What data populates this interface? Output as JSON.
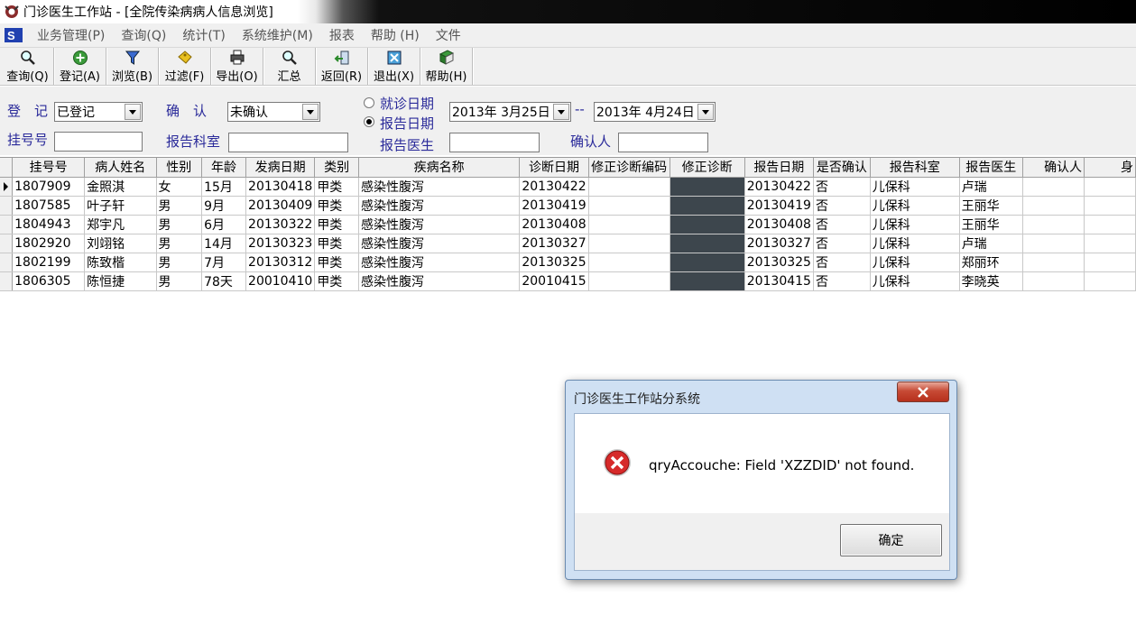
{
  "window": {
    "title": "门诊医生工作站 - [全院传染病病人信息浏览]"
  },
  "menu": [
    "业务管理(P)",
    "查询(Q)",
    "统计(T)",
    "系统维护(M)",
    "报表",
    "帮助 (H)",
    "文件"
  ],
  "toolbar": [
    {
      "label": "查询(Q)",
      "icon": "magnifier-icon"
    },
    {
      "label": "登记(A)",
      "icon": "add-circle-icon"
    },
    {
      "label": "浏览(B)",
      "icon": "funnel-icon"
    },
    {
      "label": "过滤(F)",
      "icon": "filter-tag-icon"
    },
    {
      "label": "导出(O)",
      "icon": "printer-icon"
    },
    {
      "label": "汇总",
      "icon": "magnifier-icon"
    },
    {
      "label": "返回(R)",
      "icon": "return-icon"
    },
    {
      "label": "退出(X)",
      "icon": "exit-icon"
    },
    {
      "label": "帮助(H)",
      "icon": "book-icon"
    }
  ],
  "filters": {
    "register_label": "登　记",
    "register_value": "已登记",
    "confirm_label": "确　认",
    "confirm_value": "未确认",
    "visit_date_label": "就诊日期",
    "report_date_label": "报告日期",
    "date_from": "2013年  3月25日",
    "date_sep": "--",
    "date_to": "2013年  4月24日",
    "reg_no_label": "挂号号",
    "report_dept_label": "报告科室",
    "report_doctor_label": "报告医生",
    "confirmer_label": "确认人"
  },
  "grid": {
    "columns": [
      "挂号号",
      "病人姓名",
      "性别",
      "年龄",
      "发病日期",
      "类别",
      "疾病名称",
      "诊断日期",
      "修正诊断编码",
      "修正诊断",
      "报告日期",
      "是否确认",
      "报告科室",
      "报告医生",
      "确认人",
      "身"
    ],
    "rows": [
      [
        "1807909",
        "金照淇",
        "女",
        "15月",
        "20130418",
        "甲类",
        "感染性腹泻",
        "20130422",
        "",
        "",
        "20130422",
        "否",
        "儿保科",
        "卢瑞",
        "",
        ""
      ],
      [
        "1807585",
        "叶子轩",
        "男",
        "9月",
        "20130409",
        "甲类",
        "感染性腹泻",
        "20130419",
        "",
        "",
        "20130419",
        "否",
        "儿保科",
        "王丽华",
        "",
        ""
      ],
      [
        "1804943",
        "郑宇凡",
        "男",
        "6月",
        "20130322",
        "甲类",
        "感染性腹泻",
        "20130408",
        "",
        "",
        "20130408",
        "否",
        "儿保科",
        "王丽华",
        "",
        ""
      ],
      [
        "1802920",
        "刘翊铭",
        "男",
        "14月",
        "20130323",
        "甲类",
        "感染性腹泻",
        "20130327",
        "",
        "",
        "20130327",
        "否",
        "儿保科",
        "卢瑞",
        "",
        ""
      ],
      [
        "1802199",
        "陈致楷",
        "男",
        "7月",
        "20130312",
        "甲类",
        "感染性腹泻",
        "20130325",
        "",
        "",
        "20130325",
        "否",
        "儿保科",
        "郑丽环",
        "",
        ""
      ],
      [
        "1806305",
        "陈恒捷",
        "男",
        "78天",
        "20010410",
        "甲类",
        "感染性腹泻",
        "20010415",
        "",
        "",
        "20130415",
        "否",
        "儿保科",
        "李晓英",
        "",
        ""
      ]
    ]
  },
  "dialog": {
    "title": "门诊医生工作站分系统",
    "message": "qryAccouche: Field 'XZZDID' not found.",
    "ok_label": "确定",
    "icon": "error-icon"
  }
}
